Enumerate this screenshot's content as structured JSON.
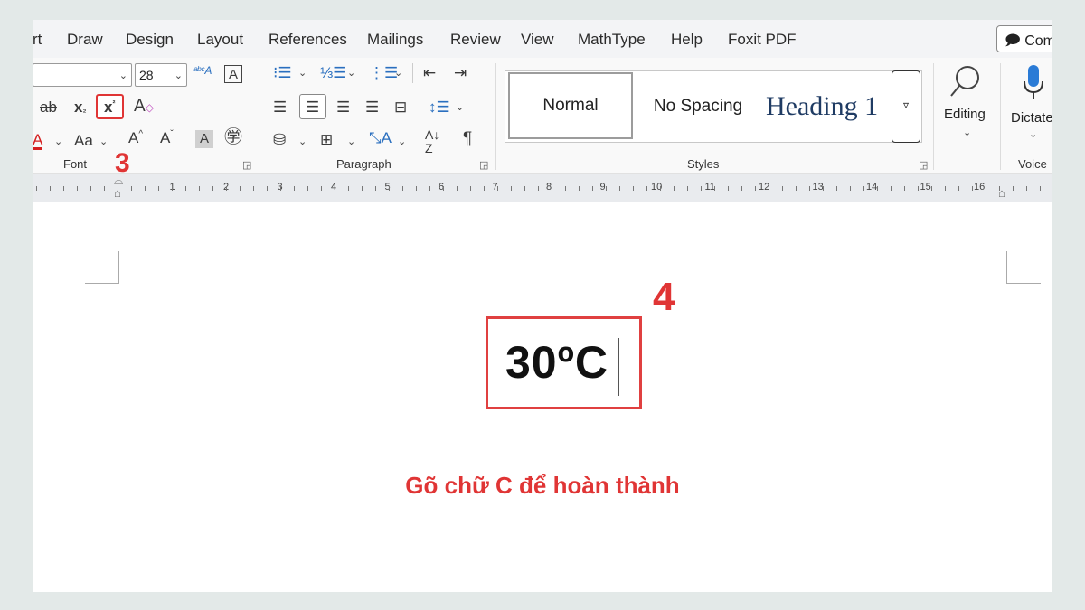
{
  "tabs": [
    "rt",
    "Draw",
    "Design",
    "Layout",
    "References",
    "Mailings",
    "Review",
    "View",
    "MathType",
    "Help",
    "Foxit PDF"
  ],
  "comments_label": "Com",
  "font": {
    "size_value": "28",
    "group_label": "Font",
    "case_label": "Aa",
    "highlight_letter": "A"
  },
  "paragraph": {
    "group_label": "Paragraph"
  },
  "styles": {
    "group_label": "Styles",
    "items": [
      "Normal",
      "No Spacing",
      "Heading 1"
    ]
  },
  "editing": {
    "label": "Editing"
  },
  "voice": {
    "dictate_label": "Dictate",
    "group_label": "Voice"
  },
  "ruler": {
    "numbers": [
      "1",
      "2",
      "3",
      "4",
      "5",
      "6",
      "7",
      "8",
      "9",
      "10",
      "11",
      "12",
      "13",
      "14",
      "15",
      "16"
    ]
  },
  "document": {
    "temperature_text": "30ºC",
    "caption": "Gõ chữ C để hoàn thành"
  },
  "annotations": {
    "step3": "3",
    "step4": "4",
    "highlight_color": "#e03535"
  }
}
